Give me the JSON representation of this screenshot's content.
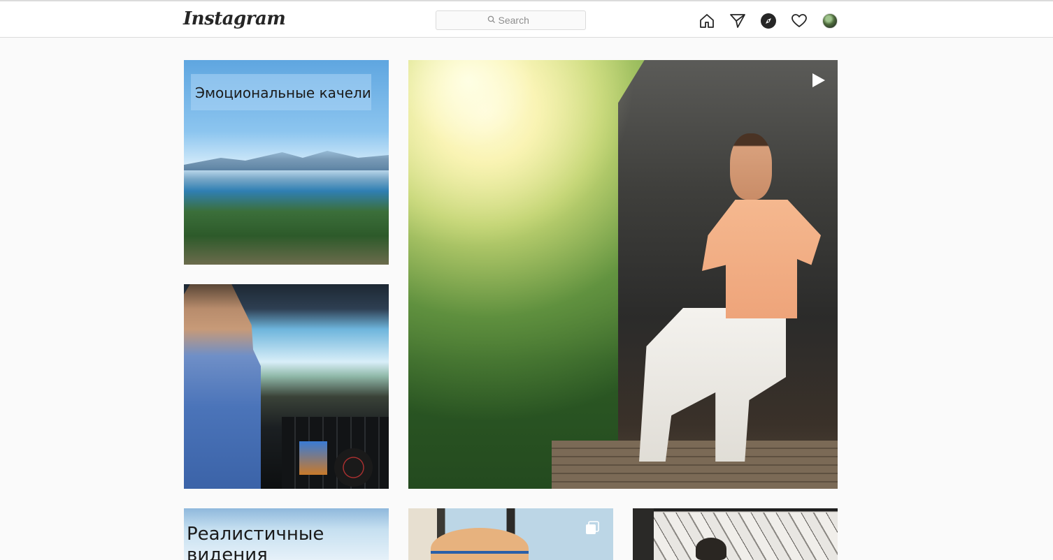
{
  "header": {
    "logo": "Instagram",
    "search": {
      "placeholder": "Search",
      "value": ""
    },
    "nav": [
      "home-icon",
      "direct-icon",
      "explore-icon",
      "activity-icon",
      "profile-avatar"
    ]
  },
  "grid": {
    "posts": [
      {
        "caption": "Эмоциональные качели",
        "type": "image"
      },
      {
        "caption": "",
        "type": "image"
      },
      {
        "caption": "",
        "type": "video",
        "badge": "play-icon"
      },
      {
        "caption": "Реалистичные видения",
        "type": "image"
      },
      {
        "caption": "",
        "type": "carousel",
        "badge": "multi-image-icon"
      },
      {
        "caption": "",
        "type": "image"
      }
    ]
  },
  "colors": {
    "background": "#fafafa",
    "header_bg": "#ffffff",
    "border": "#dbdbdb",
    "text": "#262626",
    "muted": "#8e8e8e"
  }
}
